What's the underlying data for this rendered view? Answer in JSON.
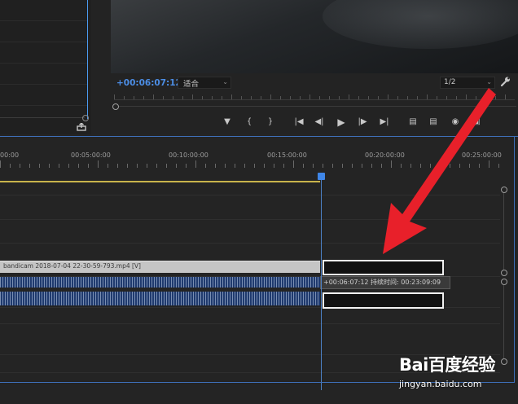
{
  "program_monitor": {
    "timecode": "+00:06:07:12",
    "zoom_select": "适合",
    "resolution_select": "1/2"
  },
  "timeline": {
    "ruler_labels": [
      "00:00",
      "00:05:00:00",
      "00:10:00:00",
      "00:15:00:00",
      "00:20:00:00",
      "00:25:00:00"
    ],
    "video_clip_label": "bandicam 2018-07-04 22-30-59-793.mp4 [V]",
    "tooltip": "+00:06:07:12  持续时间: 00:23:09:09"
  },
  "transport_icons": [
    "add-marker-icon",
    "mark-in-icon",
    "mark-out-icon",
    "go-to-in-icon",
    "step-back-icon",
    "play-icon",
    "step-forward-icon",
    "go-to-out-icon",
    "lift-icon",
    "extract-icon",
    "export-frame-icon",
    "compare-icon"
  ],
  "annotation": {
    "color": "#e8202a"
  },
  "watermark": {
    "brand": "Bai百度经验",
    "url": "jingyan.baidu.com"
  }
}
